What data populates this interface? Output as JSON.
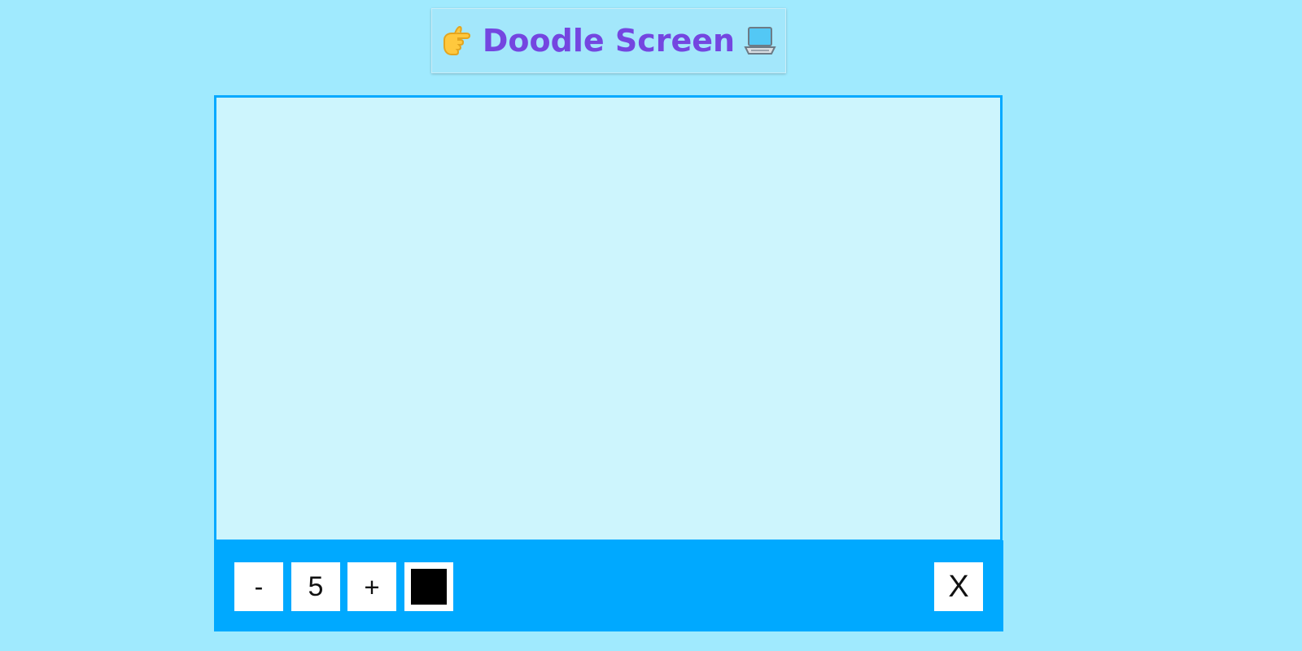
{
  "header": {
    "title": "Doodle Screen",
    "left_icon": "pointing-hand-icon",
    "right_icon": "laptop-icon",
    "title_color": "#7446e0"
  },
  "canvas": {
    "background_color": "#cdf5fd",
    "border_color": "#05a9ff"
  },
  "toolbar": {
    "background_color": "#00a9ff",
    "decrease_label": "-",
    "brush_size": "5",
    "increase_label": "+",
    "selected_color": "#000000",
    "clear_label": "X"
  }
}
